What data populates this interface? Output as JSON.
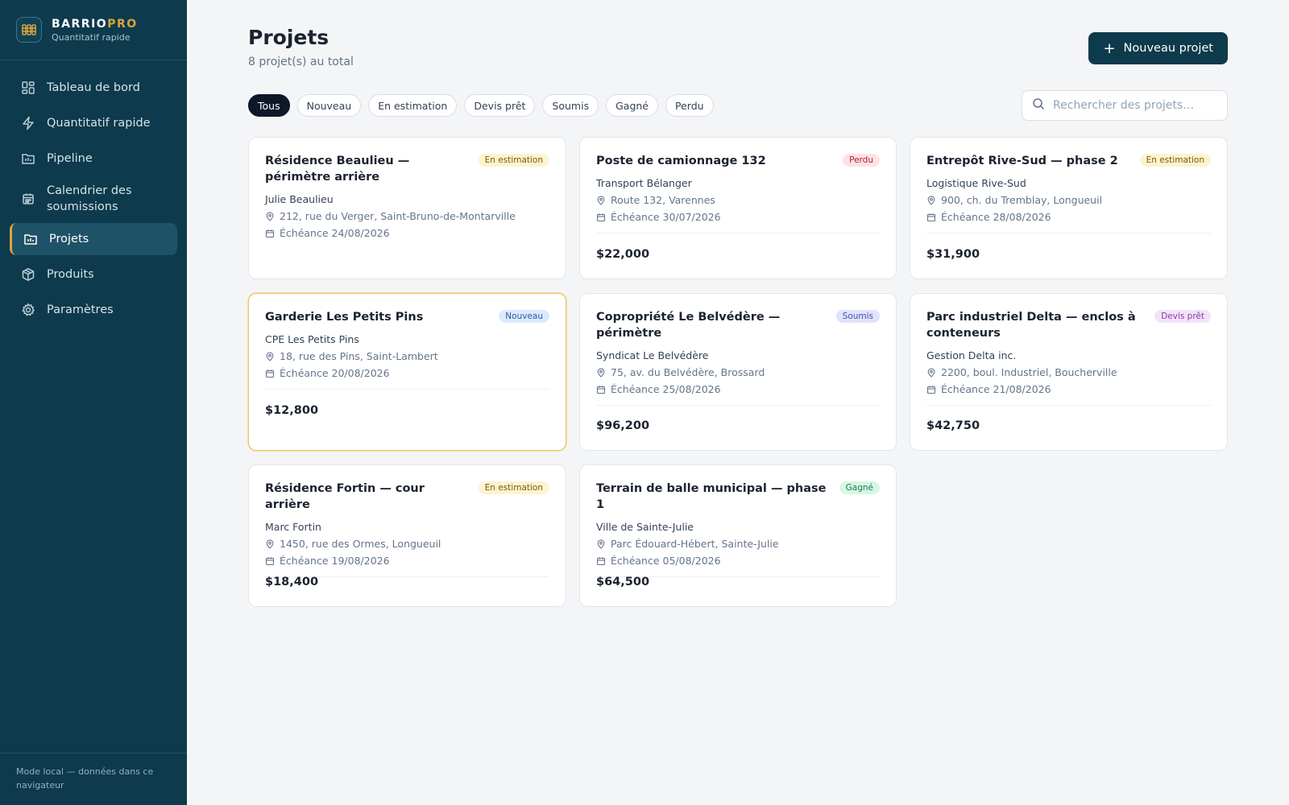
{
  "brand": {
    "name_main": "BARRIO",
    "name_accent": "PRO",
    "tagline": "Quantitatif rapide"
  },
  "sidebar": {
    "items": [
      {
        "label": "Tableau de bord",
        "icon": "dashboard-icon"
      },
      {
        "label": "Quantitatif rapide",
        "icon": "lightning-icon"
      },
      {
        "label": "Pipeline",
        "icon": "pipeline-folder-icon"
      },
      {
        "label": "Calendrier des soumissions",
        "icon": "calendar-icon"
      },
      {
        "label": "Projets",
        "icon": "projects-folder-icon",
        "active": true
      },
      {
        "label": "Produits",
        "icon": "box-icon"
      },
      {
        "label": "Paramètres",
        "icon": "gear-icon"
      }
    ],
    "footer": "Mode local — données dans ce navigateur"
  },
  "header": {
    "title": "Projets",
    "subtitle": "8 projet(s) au total",
    "new_button": "Nouveau projet"
  },
  "filters": [
    "Tous",
    "Nouveau",
    "En estimation",
    "Devis prêt",
    "Soumis",
    "Gagné",
    "Perdu"
  ],
  "active_filter": "Tous",
  "search": {
    "placeholder": "Rechercher des projets…",
    "value": ""
  },
  "projects": [
    {
      "title": "Résidence Beaulieu — périmètre arrière",
      "status": "En estimation",
      "client": "Julie Beaulieu",
      "address": "212, rue du Verger, Saint-Bruno-de-Montarville",
      "due": "Échéance 24/08/2026",
      "amount": ""
    },
    {
      "title": "Poste de camionnage 132",
      "status": "Perdu",
      "client": "Transport Bélanger",
      "address": "Route 132, Varennes",
      "due": "Échéance 30/07/2026",
      "amount": "$22,000"
    },
    {
      "title": "Entrepôt Rive-Sud — phase 2",
      "status": "En estimation",
      "client": "Logistique Rive-Sud",
      "address": "900, ch. du Tremblay, Longueuil",
      "due": "Échéance 28/08/2026",
      "amount": "$31,900"
    },
    {
      "title": "Garderie Les Petits Pins",
      "status": "Nouveau",
      "client": "CPE Les Petits Pins",
      "address": "18, rue des Pins, Saint-Lambert",
      "due": "Échéance 20/08/2026",
      "amount": "$12,800"
    },
    {
      "title": "Copropriété Le Belvédère — périmètre",
      "status": "Soumis",
      "client": "Syndicat Le Belvédère",
      "address": "75, av. du Belvédère, Brossard",
      "due": "Échéance 25/08/2026",
      "amount": "$96,200"
    },
    {
      "title": "Parc industriel Delta — enclos à conteneurs",
      "status": "Devis prêt",
      "client": "Gestion Delta inc.",
      "address": "2200, boul. Industriel, Boucherville",
      "due": "Échéance 21/08/2026",
      "amount": "$42,750"
    },
    {
      "title": "Résidence Fortin — cour arrière",
      "status": "En estimation",
      "client": "Marc Fortin",
      "address": "1450, rue des Ormes, Longueuil",
      "due": "Échéance 19/08/2026",
      "amount": "$18,400"
    },
    {
      "title": "Terrain de balle municipal — phase 1",
      "status": "Gagné",
      "client": "Ville de Sainte-Julie",
      "address": "Parc Édouard-Hébert, Sainte-Julie",
      "due": "Échéance 05/08/2026",
      "amount": "$64,500"
    }
  ]
}
